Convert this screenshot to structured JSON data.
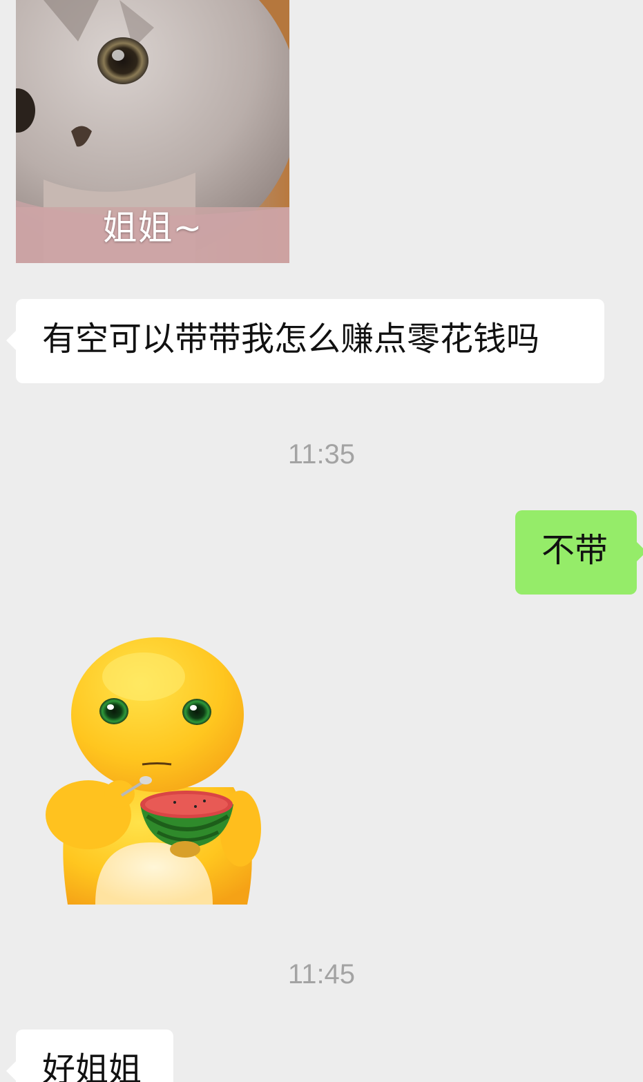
{
  "messages": [
    {
      "type": "sticker",
      "side": "left",
      "sticker_name": "cat-sticker",
      "caption": "姐姐~"
    },
    {
      "type": "text",
      "side": "left",
      "text": "有空可以带带我怎么赚点零花钱吗"
    },
    {
      "type": "timestamp",
      "text": "11:35"
    },
    {
      "type": "text",
      "side": "right",
      "text": "不带"
    },
    {
      "type": "sticker",
      "side": "left",
      "sticker_name": "yellow-creature-eating-watermelon-sticker"
    },
    {
      "type": "timestamp",
      "text": "11:45"
    },
    {
      "type": "text",
      "side": "left",
      "text": "好姐姐"
    }
  ],
  "colors": {
    "background": "#ededed",
    "incoming_bubble": "#ffffff",
    "outgoing_bubble": "#95ec69",
    "timestamp_text": "#a3a3a3"
  }
}
